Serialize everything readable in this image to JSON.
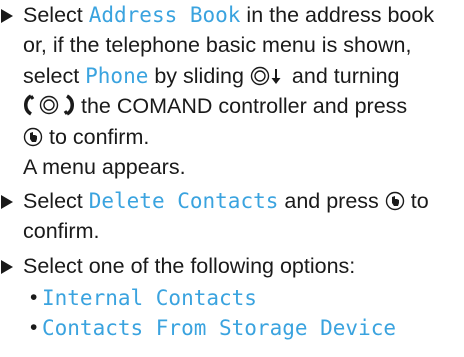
{
  "instructions": {
    "step1": {
      "pre": "Select ",
      "target1": "Address Book",
      "mid1": " in the address book",
      "line2": "or, if the telephone basic menu is shown,",
      "pre3": "select ",
      "target2": "Phone",
      "mid3": " by sliding ",
      "post3": " and turning",
      "post4": " the COMAND controller and press",
      "post5": " to confirm.",
      "result": "A menu appears."
    },
    "step2": {
      "pre": "Select ",
      "target": "Delete Contacts",
      "mid": " and press ",
      "post": " to",
      "line2": "confirm."
    },
    "step3": {
      "text": "Select one of the following options:",
      "options": [
        "Internal Contacts",
        "Contacts From Storage Device"
      ]
    }
  },
  "icons": {
    "slide": "controller-slide-down-icon",
    "turn": "controller-turn-icon",
    "press": "controller-press-icon"
  },
  "colors": {
    "menu_item": "#3aa3df",
    "text": "#1a1a1a"
  }
}
